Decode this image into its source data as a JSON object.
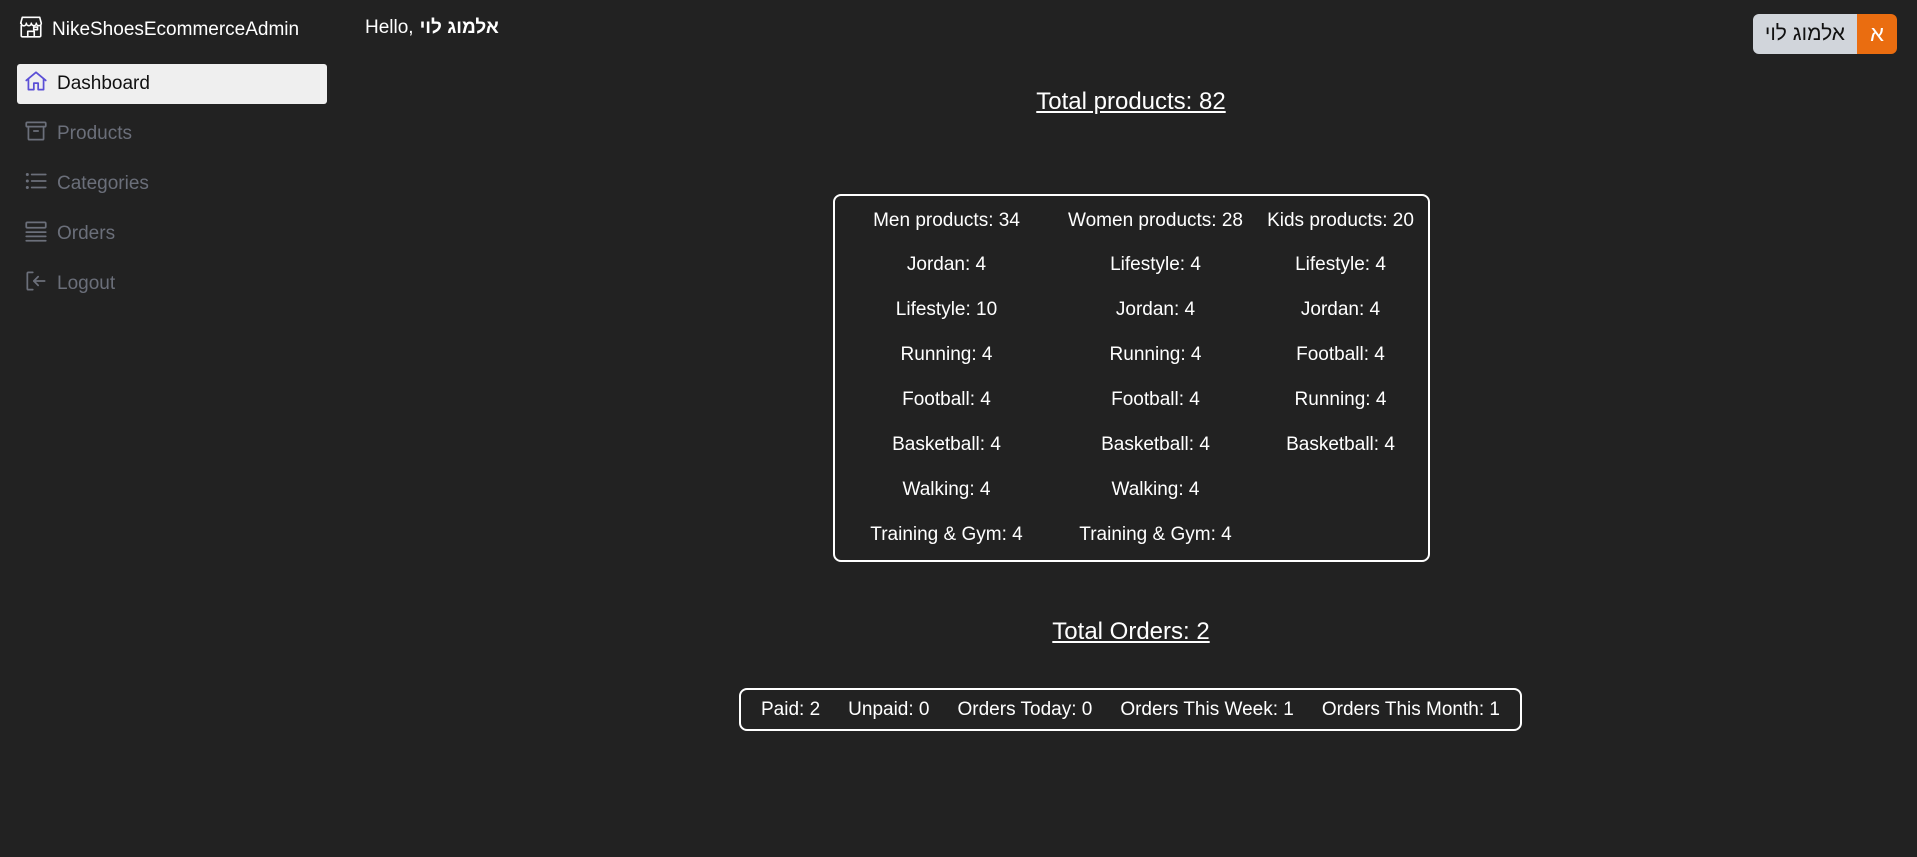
{
  "app": {
    "title": "NikeShoesEcommerceAdmin",
    "brand_icon": "store-icon"
  },
  "greeting": {
    "prefix": "Hello,",
    "user_name": "אלמוג לוי"
  },
  "user_chip": {
    "initial": "א",
    "name": "אלמוג לוי",
    "initial_color": "#ea6d10"
  },
  "sidebar": {
    "items": [
      {
        "label": "Dashboard",
        "icon": "home-icon",
        "active": true
      },
      {
        "label": "Products",
        "icon": "archive-icon",
        "active": false
      },
      {
        "label": "Categories",
        "icon": "list-icon",
        "active": false
      },
      {
        "label": "Orders",
        "icon": "queue-list-icon",
        "active": false
      },
      {
        "label": "Logout",
        "icon": "logout-icon",
        "active": false
      }
    ]
  },
  "products": {
    "title": "Total products: 82",
    "columns": [
      {
        "heading": "Men products: 34",
        "items": [
          "Jordan: 4",
          "Lifestyle: 10",
          "Running: 4",
          "Football: 4",
          "Basketball: 4",
          "Walking: 4",
          "Training & Gym: 4"
        ]
      },
      {
        "heading": "Women products: 28",
        "items": [
          "Lifestyle: 4",
          "Jordan: 4",
          "Running: 4",
          "Football: 4",
          "Basketball: 4",
          "Walking: 4",
          "Training & Gym: 4"
        ]
      },
      {
        "heading": "Kids products: 20",
        "items": [
          "Lifestyle: 4",
          "Jordan: 4",
          "Football: 4",
          "Running: 4",
          "Basketball: 4"
        ]
      }
    ]
  },
  "orders": {
    "title": "Total Orders: 2",
    "stats": [
      "Paid: 2",
      "Unpaid: 0",
      "Orders Today: 0",
      "Orders This Week: 1",
      "Orders This Month: 1"
    ]
  },
  "colors": {
    "background": "#222222",
    "sidebar_inactive": "#6b6f7a",
    "active_bg": "#efefef",
    "accent_icon": "#5b4fd6"
  }
}
